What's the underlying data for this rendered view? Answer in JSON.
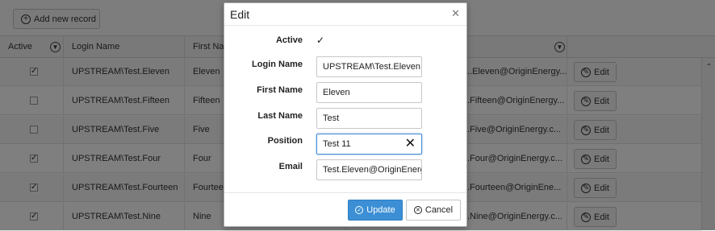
{
  "toolbar": {
    "add_label": "Add new record"
  },
  "grid": {
    "headers": {
      "active": "Active",
      "login_name": "Login Name",
      "first_name": "First Nam",
      "email": "ail"
    },
    "rows": [
      {
        "active": true,
        "login": "UPSTREAM\\Test.Eleven",
        "first": "Eleven",
        "email": "..Eleven@OriginEnergy...",
        "edit": "Edit"
      },
      {
        "active": false,
        "login": "UPSTREAM\\Test.Fifteen",
        "first": "Fifteen",
        "email": ".Fifteen@OriginEnergy...",
        "edit": "Edit"
      },
      {
        "active": false,
        "login": "UPSTREAM\\Test.Five",
        "first": "Five",
        "email": ".Five@OriginEnergy.c...",
        "edit": "Edit"
      },
      {
        "active": true,
        "login": "UPSTREAM\\Test.Four",
        "first": "Four",
        "email": ".Four@OriginEnergy.c...",
        "edit": "Edit"
      },
      {
        "active": true,
        "login": "UPSTREAM\\Test.Fourteen",
        "first": "Fourteen",
        "email": ".Fourteen@OriginEne...",
        "edit": "Edit"
      },
      {
        "active": true,
        "login": "UPSTREAM\\Test.Nine",
        "first": "Nine",
        "email": ".Nine@OriginEnergy.c...",
        "edit": "Edit"
      }
    ]
  },
  "modal": {
    "title": "Edit",
    "fields": {
      "active_label": "Active",
      "active_checked": true,
      "login_label": "Login Name",
      "login_value": "UPSTREAM\\Test.Eleven",
      "first_label": "First Name",
      "first_value": "Eleven",
      "last_label": "Last Name",
      "last_value": "Test",
      "position_label": "Position",
      "position_value": "Test 11",
      "email_label": "Email",
      "email_value": "Test.Eleven@OriginEnergy"
    },
    "update_label": "Update",
    "cancel_label": "Cancel"
  },
  "colors": {
    "primary": "#3c8fd4",
    "overlay": "rgba(0,0,0,0.5)"
  }
}
